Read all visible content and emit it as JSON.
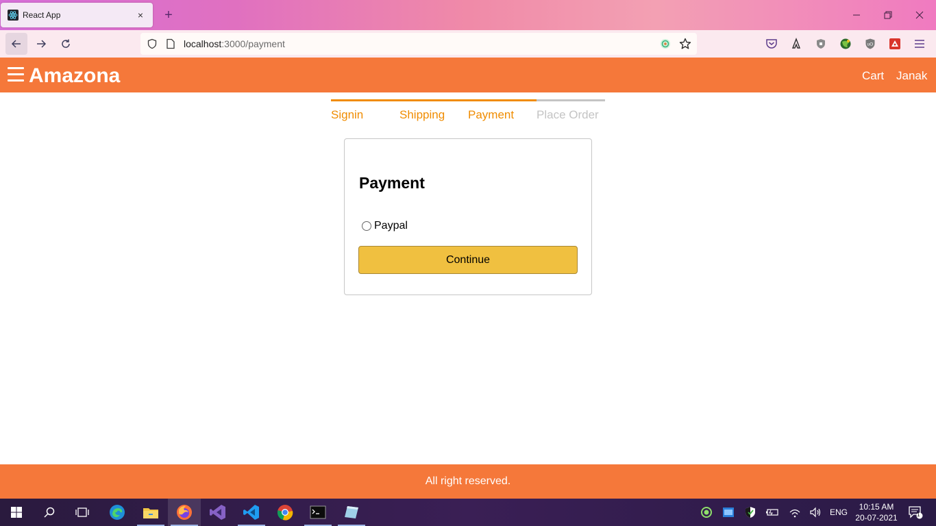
{
  "browser": {
    "tab_title": "React App",
    "tab_close": "×",
    "new_tab": "+",
    "url_host": "localhost",
    "url_path": ":3000/payment"
  },
  "app": {
    "brand": "Amazona",
    "nav": {
      "cart": "Cart",
      "user": "Janak"
    },
    "steps": [
      {
        "label": "Signin",
        "active": true
      },
      {
        "label": "Shipping",
        "active": true
      },
      {
        "label": "Payment",
        "active": true
      },
      {
        "label": "Place Order",
        "active": false
      }
    ],
    "payment": {
      "title": "Payment",
      "option_label": "Paypal",
      "continue_label": "Continue"
    },
    "footer": "All right reserved."
  },
  "taskbar": {
    "lang": "ENG",
    "time": "10:15 AM",
    "date": "20-07-2021",
    "notifications": "1"
  },
  "colors": {
    "brand_orange": "#f5783a",
    "step_active": "#f08c00",
    "button_yellow": "#f0c040"
  }
}
